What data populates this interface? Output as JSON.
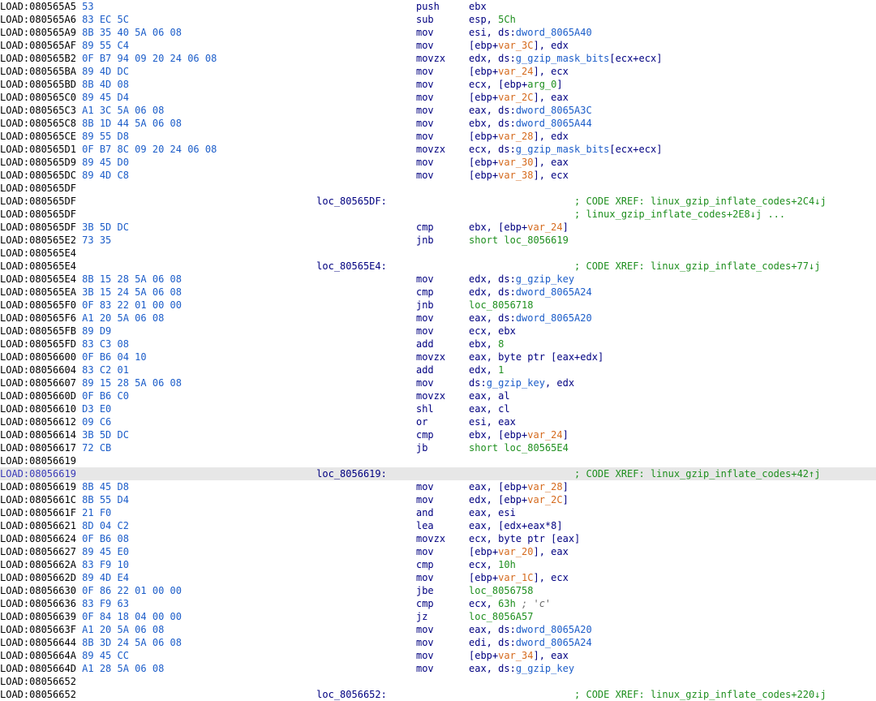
{
  "col_seg": 0,
  "col_hex": 14,
  "col_loc": 54,
  "col_mn": 71,
  "col_op": 80,
  "col_cmt": 98,
  "lines": [
    {
      "addr": "LOAD:080565A5",
      "hex": "53",
      "mn": "push",
      "op": [
        {
          "t": "opr",
          "v": "ebx"
        }
      ]
    },
    {
      "addr": "LOAD:080565A6",
      "hex": "83 EC 5C",
      "mn": "sub",
      "op": [
        {
          "t": "opr",
          "v": "esp, "
        },
        {
          "t": "imm",
          "v": "5Ch"
        }
      ]
    },
    {
      "addr": "LOAD:080565A9",
      "hex": "8B 35 40 5A 06 08",
      "mn": "mov",
      "op": [
        {
          "t": "opr",
          "v": "esi, ds:"
        },
        {
          "t": "sym",
          "v": "dword_8065A40"
        }
      ]
    },
    {
      "addr": "LOAD:080565AF",
      "hex": "89 55 C4",
      "mn": "mov",
      "op": [
        {
          "t": "opr",
          "v": "[ebp+"
        },
        {
          "t": "var",
          "v": "var_3C"
        },
        {
          "t": "opr",
          "v": "], edx"
        }
      ]
    },
    {
      "addr": "LOAD:080565B2",
      "hex": "0F B7 94 09 20 24 06 08",
      "mn": "movzx",
      "op": [
        {
          "t": "opr",
          "v": "edx, ds:"
        },
        {
          "t": "sym",
          "v": "g_gzip_mask_bits"
        },
        {
          "t": "opr",
          "v": "[ecx+ecx]"
        }
      ]
    },
    {
      "addr": "LOAD:080565BA",
      "hex": "89 4D DC",
      "mn": "mov",
      "op": [
        {
          "t": "opr",
          "v": "[ebp+"
        },
        {
          "t": "var",
          "v": "var_24"
        },
        {
          "t": "opr",
          "v": "], ecx"
        }
      ]
    },
    {
      "addr": "LOAD:080565BD",
      "hex": "8B 4D 08",
      "mn": "mov",
      "op": [
        {
          "t": "opr",
          "v": "ecx, [ebp+"
        },
        {
          "t": "imm",
          "v": "arg_0"
        },
        {
          "t": "opr",
          "v": "]"
        }
      ]
    },
    {
      "addr": "LOAD:080565C0",
      "hex": "89 45 D4",
      "mn": "mov",
      "op": [
        {
          "t": "opr",
          "v": "[ebp+"
        },
        {
          "t": "var",
          "v": "var_2C"
        },
        {
          "t": "opr",
          "v": "], eax"
        }
      ]
    },
    {
      "addr": "LOAD:080565C3",
      "hex": "A1 3C 5A 06 08",
      "mn": "mov",
      "op": [
        {
          "t": "opr",
          "v": "eax, ds:"
        },
        {
          "t": "sym",
          "v": "dword_8065A3C"
        }
      ]
    },
    {
      "addr": "LOAD:080565C8",
      "hex": "8B 1D 44 5A 06 08",
      "mn": "mov",
      "op": [
        {
          "t": "opr",
          "v": "ebx, ds:"
        },
        {
          "t": "sym",
          "v": "dword_8065A44"
        }
      ]
    },
    {
      "addr": "LOAD:080565CE",
      "hex": "89 55 D8",
      "mn": "mov",
      "op": [
        {
          "t": "opr",
          "v": "[ebp+"
        },
        {
          "t": "var",
          "v": "var_28"
        },
        {
          "t": "opr",
          "v": "], edx"
        }
      ]
    },
    {
      "addr": "LOAD:080565D1",
      "hex": "0F B7 8C 09 20 24 06 08",
      "mn": "movzx",
      "op": [
        {
          "t": "opr",
          "v": "ecx, ds:"
        },
        {
          "t": "sym",
          "v": "g_gzip_mask_bits"
        },
        {
          "t": "opr",
          "v": "[ecx+ecx]"
        }
      ]
    },
    {
      "addr": "LOAD:080565D9",
      "hex": "89 45 D0",
      "mn": "mov",
      "op": [
        {
          "t": "opr",
          "v": "[ebp+"
        },
        {
          "t": "var",
          "v": "var_30"
        },
        {
          "t": "opr",
          "v": "], eax"
        }
      ]
    },
    {
      "addr": "LOAD:080565DC",
      "hex": "89 4D C8",
      "mn": "mov",
      "op": [
        {
          "t": "opr",
          "v": "[ebp+"
        },
        {
          "t": "var",
          "v": "var_38"
        },
        {
          "t": "opr",
          "v": "], ecx"
        }
      ]
    },
    {
      "addr": "LOAD:080565DF"
    },
    {
      "addr": "LOAD:080565DF",
      "loc": "loc_80565DF:",
      "xref": "; CODE XREF: linux_gzip_inflate_codes+2C4↓j"
    },
    {
      "addr": "LOAD:080565DF",
      "xref": "; linux_gzip_inflate_codes+2E8↓j ..."
    },
    {
      "addr": "LOAD:080565DF",
      "hex": "3B 5D DC",
      "mn": "cmp",
      "op": [
        {
          "t": "opr",
          "v": "ebx, [ebp+"
        },
        {
          "t": "var",
          "v": "var_24"
        },
        {
          "t": "opr",
          "v": "]"
        }
      ]
    },
    {
      "addr": "LOAD:080565E2",
      "hex": "73 35",
      "mn": "jnb",
      "op": [
        {
          "t": "loc_ref",
          "v": "short loc_8056619"
        }
      ]
    },
    {
      "addr": "LOAD:080565E4"
    },
    {
      "addr": "LOAD:080565E4",
      "loc": "loc_80565E4:",
      "xref": "; CODE XREF: linux_gzip_inflate_codes+77↓j"
    },
    {
      "addr": "LOAD:080565E4",
      "hex": "8B 15 28 5A 06 08",
      "mn": "mov",
      "op": [
        {
          "t": "opr",
          "v": "edx, ds:"
        },
        {
          "t": "sym",
          "v": "g_gzip_key"
        }
      ]
    },
    {
      "addr": "LOAD:080565EA",
      "hex": "3B 15 24 5A 06 08",
      "mn": "cmp",
      "op": [
        {
          "t": "opr",
          "v": "edx, ds:"
        },
        {
          "t": "sym",
          "v": "dword_8065A24"
        }
      ]
    },
    {
      "addr": "LOAD:080565F0",
      "hex": "0F 83 22 01 00 00",
      "mn": "jnb",
      "op": [
        {
          "t": "loc_ref",
          "v": "loc_8056718"
        }
      ]
    },
    {
      "addr": "LOAD:080565F6",
      "hex": "A1 20 5A 06 08",
      "mn": "mov",
      "op": [
        {
          "t": "opr",
          "v": "eax, ds:"
        },
        {
          "t": "sym",
          "v": "dword_8065A20"
        }
      ]
    },
    {
      "addr": "LOAD:080565FB",
      "hex": "89 D9",
      "mn": "mov",
      "op": [
        {
          "t": "opr",
          "v": "ecx, ebx"
        }
      ]
    },
    {
      "addr": "LOAD:080565FD",
      "hex": "83 C3 08",
      "mn": "add",
      "op": [
        {
          "t": "opr",
          "v": "ebx, "
        },
        {
          "t": "imm",
          "v": "8"
        }
      ]
    },
    {
      "addr": "LOAD:08056600",
      "hex": "0F B6 04 10",
      "mn": "movzx",
      "op": [
        {
          "t": "opr",
          "v": "eax, byte ptr [eax+edx]"
        }
      ]
    },
    {
      "addr": "LOAD:08056604",
      "hex": "83 C2 01",
      "mn": "add",
      "op": [
        {
          "t": "opr",
          "v": "edx, "
        },
        {
          "t": "imm",
          "v": "1"
        }
      ]
    },
    {
      "addr": "LOAD:08056607",
      "hex": "89 15 28 5A 06 08",
      "mn": "mov",
      "op": [
        {
          "t": "opr",
          "v": "ds:"
        },
        {
          "t": "sym",
          "v": "g_gzip_key"
        },
        {
          "t": "opr",
          "v": ", edx"
        }
      ]
    },
    {
      "addr": "LOAD:0805660D",
      "hex": "0F B6 C0",
      "mn": "movzx",
      "op": [
        {
          "t": "opr",
          "v": "eax, al"
        }
      ]
    },
    {
      "addr": "LOAD:08056610",
      "hex": "D3 E0",
      "mn": "shl",
      "op": [
        {
          "t": "opr",
          "v": "eax, cl"
        }
      ]
    },
    {
      "addr": "LOAD:08056612",
      "hex": "09 C6",
      "mn": "or",
      "op": [
        {
          "t": "opr",
          "v": "esi, eax"
        }
      ]
    },
    {
      "addr": "LOAD:08056614",
      "hex": "3B 5D DC",
      "mn": "cmp",
      "op": [
        {
          "t": "opr",
          "v": "ebx, [ebp+"
        },
        {
          "t": "var",
          "v": "var_24"
        },
        {
          "t": "opr",
          "v": "]"
        }
      ]
    },
    {
      "addr": "LOAD:08056617",
      "hex": "72 CB",
      "mn": "jb",
      "op": [
        {
          "t": "loc_ref",
          "v": "short loc_80565E4"
        }
      ]
    },
    {
      "addr": "LOAD:08056619"
    },
    {
      "addr": "LOAD:08056619",
      "addr_cur": true,
      "loc": "loc_8056619:",
      "hl": true,
      "xref": "; CODE XREF: linux_gzip_inflate_codes+42↑j"
    },
    {
      "addr": "LOAD:08056619",
      "hex": "8B 45 D8",
      "mn": "mov",
      "op": [
        {
          "t": "opr",
          "v": "eax, [ebp+"
        },
        {
          "t": "var",
          "v": "var_28"
        },
        {
          "t": "opr",
          "v": "]"
        }
      ]
    },
    {
      "addr": "LOAD:0805661C",
      "hex": "8B 55 D4",
      "mn": "mov",
      "op": [
        {
          "t": "opr",
          "v": "edx, [ebp+"
        },
        {
          "t": "var",
          "v": "var_2C"
        },
        {
          "t": "opr",
          "v": "]"
        }
      ]
    },
    {
      "addr": "LOAD:0805661F",
      "hex": "21 F0",
      "mn": "and",
      "op": [
        {
          "t": "opr",
          "v": "eax, esi"
        }
      ]
    },
    {
      "addr": "LOAD:08056621",
      "hex": "8D 04 C2",
      "mn": "lea",
      "op": [
        {
          "t": "opr",
          "v": "eax, [edx+eax*8]"
        }
      ]
    },
    {
      "addr": "LOAD:08056624",
      "hex": "0F B6 08",
      "mn": "movzx",
      "op": [
        {
          "t": "opr",
          "v": "ecx, byte ptr [eax]"
        }
      ]
    },
    {
      "addr": "LOAD:08056627",
      "hex": "89 45 E0",
      "mn": "mov",
      "op": [
        {
          "t": "opr",
          "v": "[ebp+"
        },
        {
          "t": "var",
          "v": "var_20"
        },
        {
          "t": "opr",
          "v": "], eax"
        }
      ]
    },
    {
      "addr": "LOAD:0805662A",
      "hex": "83 F9 10",
      "mn": "cmp",
      "op": [
        {
          "t": "opr",
          "v": "ecx, "
        },
        {
          "t": "imm",
          "v": "10h"
        }
      ]
    },
    {
      "addr": "LOAD:0805662D",
      "hex": "89 4D E4",
      "mn": "mov",
      "op": [
        {
          "t": "opr",
          "v": "[ebp+"
        },
        {
          "t": "var",
          "v": "var_1C"
        },
        {
          "t": "opr",
          "v": "], ecx"
        }
      ]
    },
    {
      "addr": "LOAD:08056630",
      "hex": "0F 86 22 01 00 00",
      "mn": "jbe",
      "op": [
        {
          "t": "loc_ref",
          "v": "loc_8056758"
        }
      ]
    },
    {
      "addr": "LOAD:08056636",
      "hex": "83 F9 63",
      "mn": "cmp",
      "op": [
        {
          "t": "opr",
          "v": "ecx, "
        },
        {
          "t": "imm",
          "v": "63h "
        },
        {
          "t": "cmt",
          "v": "; 'c'"
        }
      ]
    },
    {
      "addr": "LOAD:08056639",
      "hex": "0F 84 18 04 00 00",
      "mn": "jz",
      "op": [
        {
          "t": "loc_ref",
          "v": "loc_8056A57"
        }
      ]
    },
    {
      "addr": "LOAD:0805663F",
      "hex": "A1 20 5A 06 08",
      "mn": "mov",
      "op": [
        {
          "t": "opr",
          "v": "eax, ds:"
        },
        {
          "t": "sym",
          "v": "dword_8065A20"
        }
      ]
    },
    {
      "addr": "LOAD:08056644",
      "hex": "8B 3D 24 5A 06 08",
      "mn": "mov",
      "op": [
        {
          "t": "opr",
          "v": "edi, ds:"
        },
        {
          "t": "sym",
          "v": "dword_8065A24"
        }
      ]
    },
    {
      "addr": "LOAD:0805664A",
      "hex": "89 45 CC",
      "mn": "mov",
      "op": [
        {
          "t": "opr",
          "v": "[ebp+"
        },
        {
          "t": "var",
          "v": "var_34"
        },
        {
          "t": "opr",
          "v": "], eax"
        }
      ]
    },
    {
      "addr": "LOAD:0805664D",
      "hex": "A1 28 5A 06 08",
      "mn": "mov",
      "op": [
        {
          "t": "opr",
          "v": "eax, ds:"
        },
        {
          "t": "sym",
          "v": "g_gzip_key"
        }
      ]
    },
    {
      "addr": "LOAD:08056652"
    },
    {
      "addr": "LOAD:08056652",
      "loc": "loc_8056652:",
      "xref": "; CODE XREF: linux_gzip_inflate_codes+220↓j"
    }
  ]
}
